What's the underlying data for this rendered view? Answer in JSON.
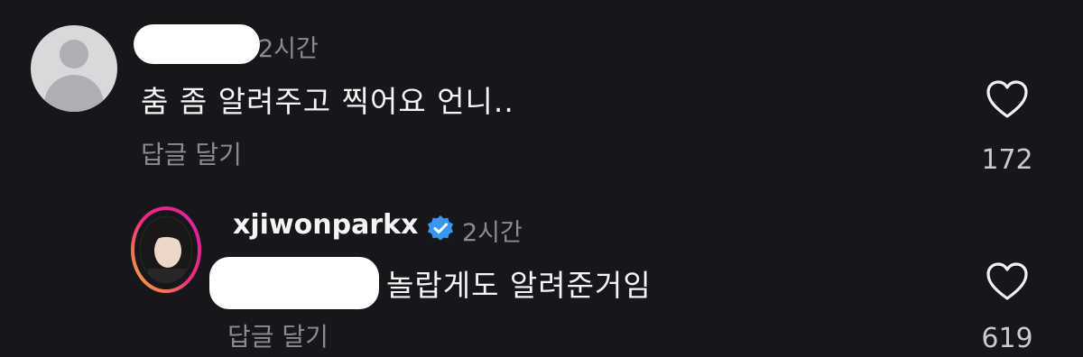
{
  "comments": [
    {
      "time": "2시간",
      "text": "춤 좀 알려주고 찍어요 언니..",
      "reply_label": "답글 달기",
      "like_count": "172",
      "avatar_icon": "default-avatar-icon",
      "like_icon": "heart-outline-icon"
    },
    {
      "username": "xjiwonparkx",
      "verified_icon": "verified-badge-icon",
      "time": "2시간",
      "text": "놀랍게도 알려준거임",
      "reply_label": "답글 달기",
      "like_count": "619",
      "avatar_icon": "profile-photo-with-story-ring",
      "like_icon": "heart-outline-icon"
    }
  ],
  "colors": {
    "background": "#15171b",
    "muted_text": "#8a8c91",
    "verified_blue": "#3897f0",
    "story_ring_start": "#f9b233",
    "story_ring_end": "#d6249f"
  }
}
